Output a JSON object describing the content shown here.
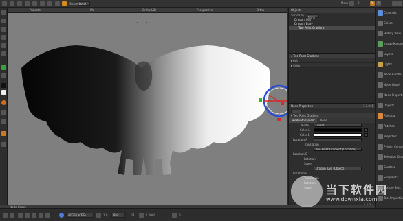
{
  "topbar": {
    "space_label": "Space",
    "space_value": "Local",
    "mode_label": "Mask",
    "frame_value": "0",
    "buttons_right": [
      "Y",
      "Z"
    ]
  },
  "viewport_tabs": [
    "Projects",
    "UV",
    "Ortho(U2)",
    "Perspective",
    "Ortho"
  ],
  "outliner": {
    "title": "Objects",
    "sorted_label": "Sorted by",
    "sorted_value": "None",
    "items": [
      {
        "label": "Dragon_Uvs",
        "indent": 1,
        "selected": false
      },
      {
        "label": "Dragon_Body",
        "indent": 1,
        "selected": false
      },
      {
        "label": "Two Point Gradient",
        "indent": 2,
        "selected": true
      }
    ]
  },
  "properties": {
    "rows": [
      {
        "label": "▾ Two Point Gradient",
        "highlight": true
      },
      {
        "label": "▸ Info",
        "highlight": false
      },
      {
        "label": "▸ Color",
        "highlight": false
      }
    ]
  },
  "node_properties": {
    "title": "Node Properties",
    "version": "1.3.0v1",
    "subhead": "▾ Two Point Gradient",
    "tabs": [
      {
        "label": "TwoPointGradient",
        "active": true
      },
      {
        "label": "Node",
        "active": false
      }
    ],
    "rows": [
      {
        "label": "Mode",
        "value": "Linear"
      },
      {
        "label": "Color A",
        "value": ""
      },
      {
        "label": "Color B",
        "value": ""
      },
      {
        "label": "Location A",
        "value": ""
      },
      {
        "label": "Translation",
        "value": ""
      },
      {
        "label": "",
        "value": "Two Point Gradient (Location)"
      },
      {
        "label": "Location B",
        "value": ""
      },
      {
        "label": "Rotation",
        "value": ""
      },
      {
        "label": "Scale",
        "value": ""
      },
      {
        "label": "",
        "value": "Dragon_Uvs (Object)"
      },
      {
        "label": "Location B",
        "value": ""
      },
      {
        "label": "Translation",
        "value": ""
      },
      {
        "label": "Rotation",
        "value": ""
      },
      {
        "label": "Scale",
        "value": ""
      }
    ],
    "footer": "1.3.0v1"
  },
  "right_shelf": [
    "Channels",
    "Colors",
    "History View",
    "Image Manager",
    "Layers",
    "Lights",
    "Node Bundle",
    "Node Graph",
    "Node Properties",
    "Objects",
    "Painting",
    "Patches",
    "Projection",
    "Python Console",
    "Selection Groups",
    "Shaders",
    "Snapshots",
    "Texture Sets",
    "Tool Properties"
  ],
  "node_graph_title": "Node Graph",
  "bottombar": {
    "colorspace": "sRGB (ACES)",
    "gain_value": "1.0",
    "bit_depth": "8bit",
    "zoom_label": "f/8",
    "gamma_value": "1.0000",
    "exposure": "0"
  },
  "watermark": {
    "text": "当下软件园",
    "url": "www.downxia.com"
  }
}
